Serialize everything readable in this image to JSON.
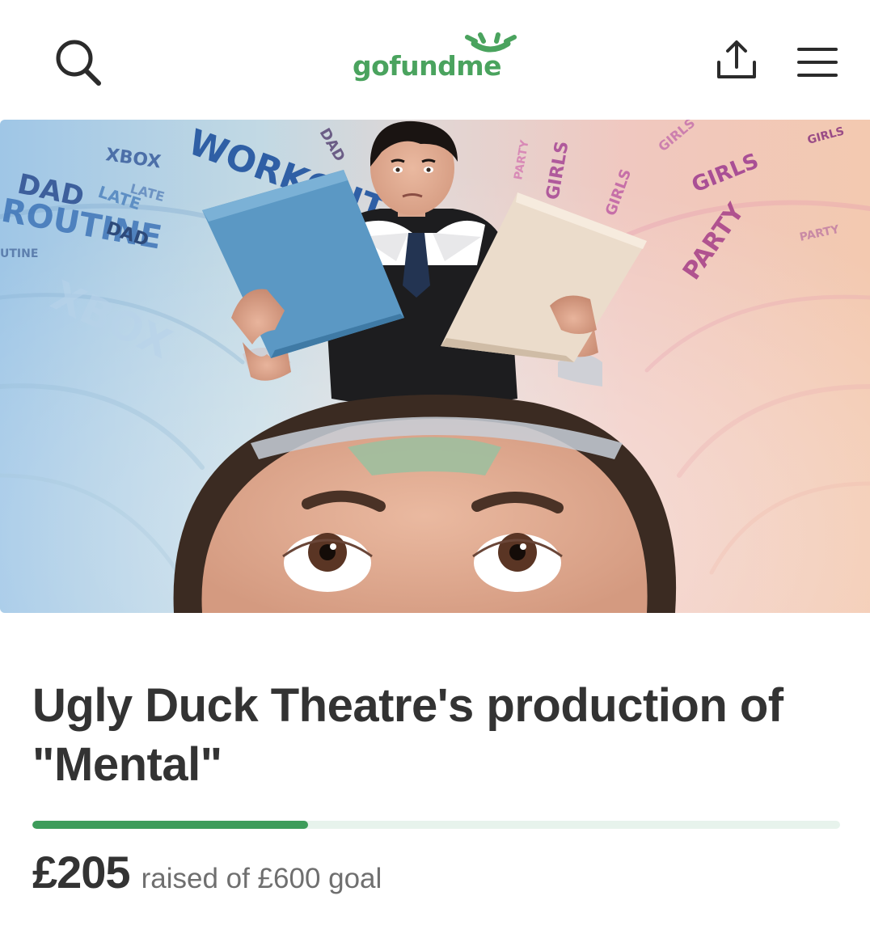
{
  "header": {
    "logo_text": "gofundme",
    "search_icon": "search-icon",
    "share_icon": "share-icon",
    "menu_icon": "hamburger-menu-icon"
  },
  "campaign": {
    "title": "Ugly Duck Theatre's production of \"Mental\"",
    "raised": "£205",
    "raised_label": "raised of £600 goal",
    "progress_fraction": 0.3417
  },
  "hero_words": {
    "left": [
      "DAD",
      "LATE",
      "ROUTINE",
      "XBOX",
      "WORKOUT",
      "DAD",
      "LATE",
      "UTINE",
      "XBOX"
    ],
    "right": [
      "GIRLS",
      "PARTY",
      "GIRLS",
      "PARTY",
      "GIRLS",
      "PARTY"
    ]
  },
  "colors": {
    "brand_green": "#4aa35e",
    "progress_fill": "#3d9c5a",
    "progress_track": "#e7f3ec",
    "title_text": "#333333",
    "label_text": "#6f6f6f"
  }
}
